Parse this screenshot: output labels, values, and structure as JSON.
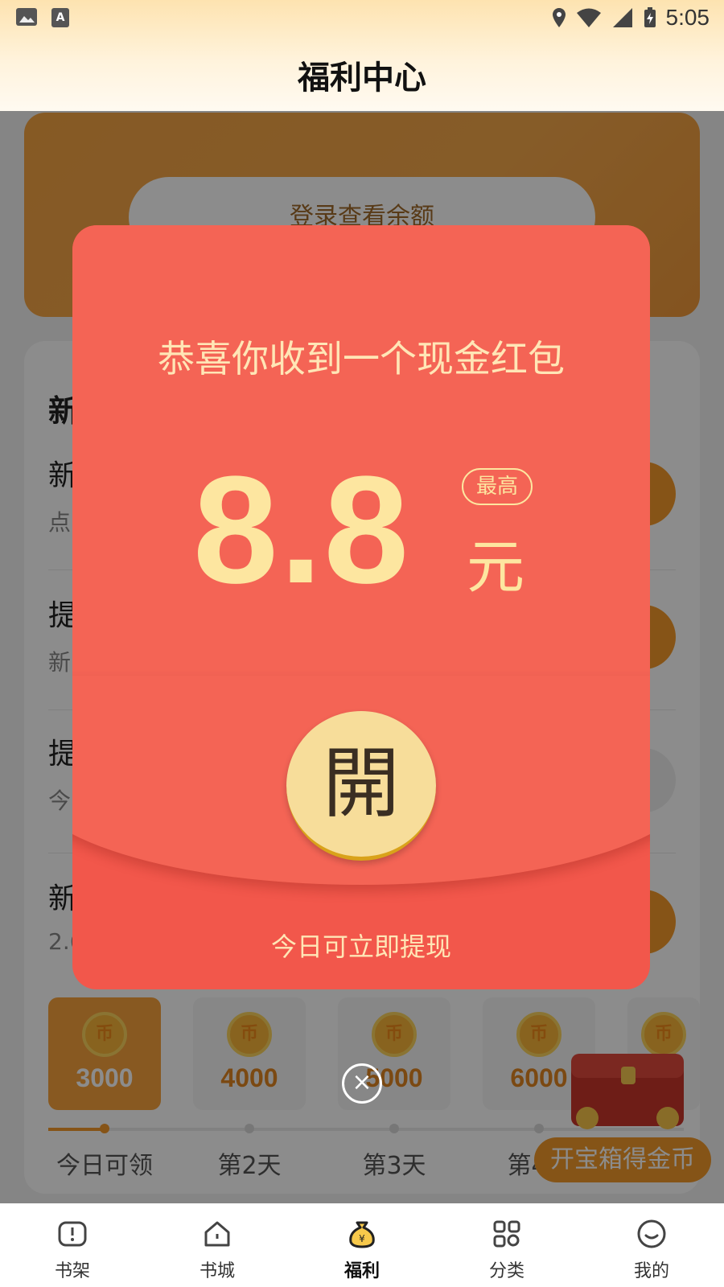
{
  "status_bar": {
    "time": "5:05"
  },
  "header": {
    "title": "福利中心"
  },
  "balance": {
    "login_label": "登录查看余额"
  },
  "tasks": {
    "section_title_partial": "新",
    "rows": [
      {
        "name_partial": "新",
        "sub_partial": "点"
      },
      {
        "name_partial": "提",
        "sub_partial": "新"
      },
      {
        "name_partial": "提",
        "sub_partial": "今"
      },
      {
        "name_partial": "新",
        "sub_partial": "2.6"
      }
    ]
  },
  "checkin": {
    "days": [
      {
        "amount": "3000",
        "label": "今日可领",
        "active": true
      },
      {
        "amount": "4000",
        "label": "第2天",
        "active": false
      },
      {
        "amount": "5000",
        "label": "第3天",
        "active": false
      },
      {
        "amount": "6000",
        "label": "第4天",
        "active": false
      },
      {
        "amount": "",
        "label": "",
        "active": false
      }
    ],
    "coin_glyph": "币"
  },
  "chest": {
    "label": "开宝箱得金币"
  },
  "red_envelope": {
    "headline": "恭喜你收到一个现金红包",
    "amount": "8.8",
    "max_badge": "最高",
    "unit": "元",
    "open_label": "開",
    "footer": "今日可立即提现",
    "colors": {
      "body": "#f2574b",
      "text": "#fde6a0"
    }
  },
  "close_icon": "×",
  "bottom_nav": [
    {
      "label": "书架",
      "icon": "bookshelf-icon"
    },
    {
      "label": "书城",
      "icon": "bookstore-icon"
    },
    {
      "label": "福利",
      "icon": "money-bag-icon",
      "active": true
    },
    {
      "label": "分类",
      "icon": "category-icon"
    },
    {
      "label": "我的",
      "icon": "profile-icon"
    }
  ]
}
